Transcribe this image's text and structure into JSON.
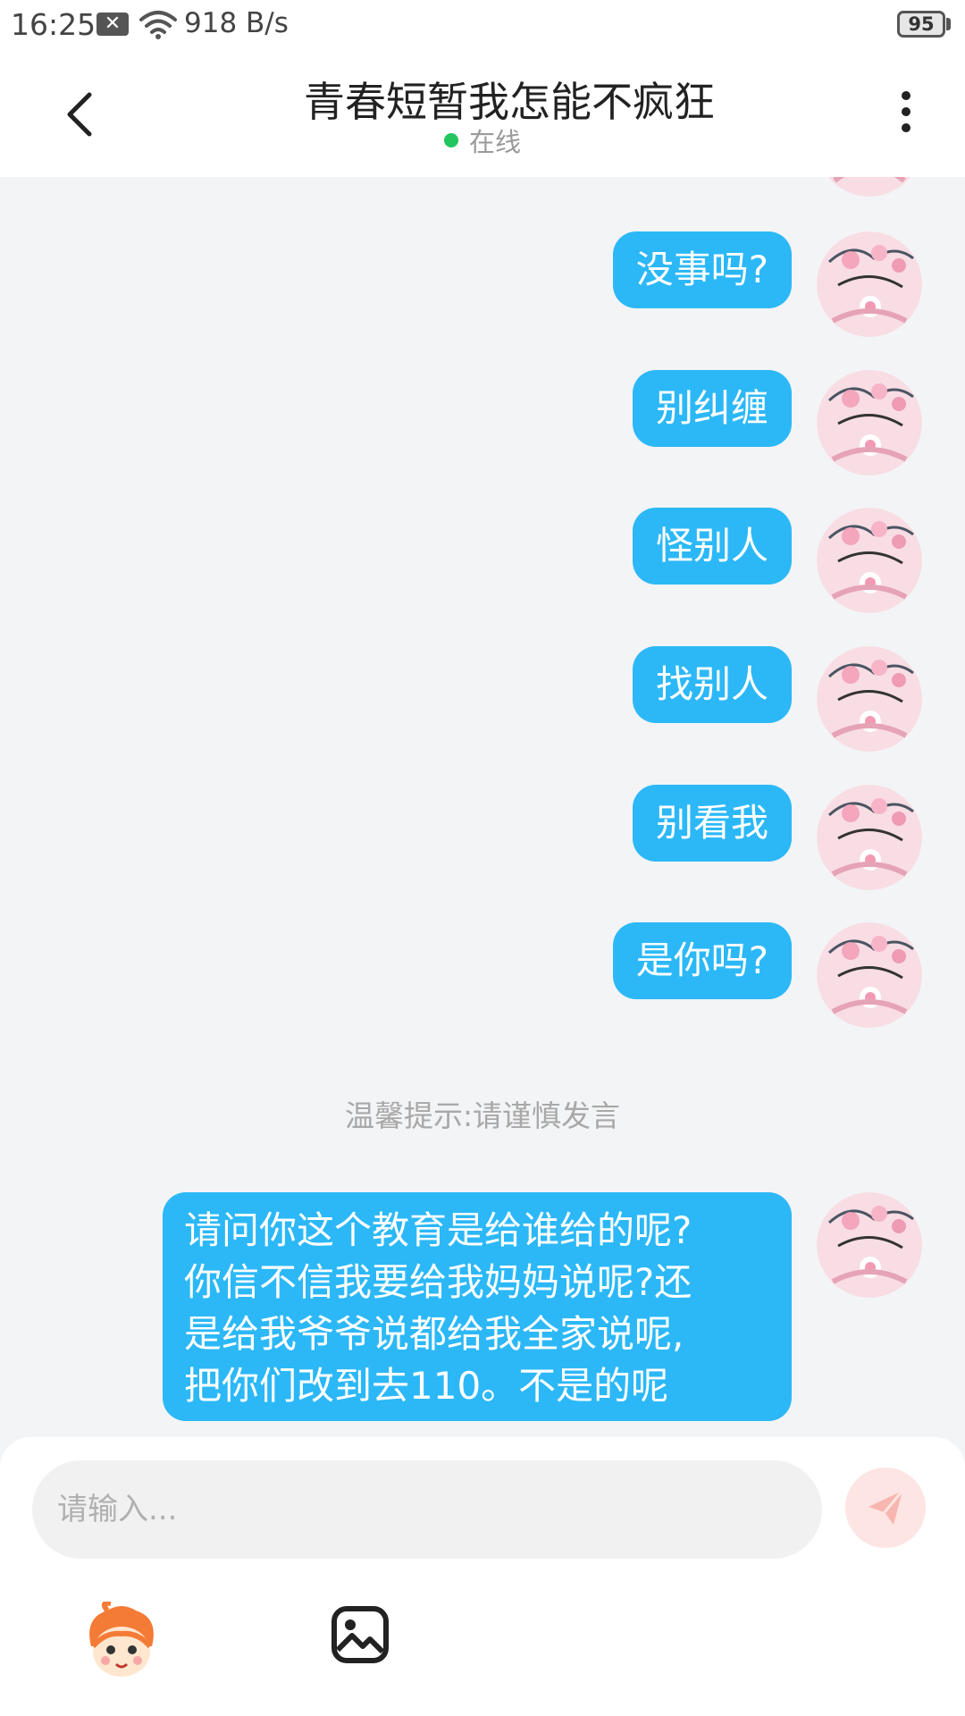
{
  "status_bar": {
    "time": "16:25",
    "notification_icon": "x-box-icon",
    "wifi_icon": "wifi-icon",
    "net_speed": "918 B/s",
    "battery": "95"
  },
  "header": {
    "back_icon": "chevron-left-icon",
    "title": "青春短暂我怎能不疯狂",
    "presence": "在线",
    "presence_color": "#22c55e",
    "more_icon": "more-vertical-icon"
  },
  "messages": [
    {
      "text": "没事吗?"
    },
    {
      "text": "别纠缠"
    },
    {
      "text": "怪别人"
    },
    {
      "text": "找别人"
    },
    {
      "text": "别看我"
    },
    {
      "text": "是你吗?"
    }
  ],
  "tip": "温馨提示:请谨慎发言",
  "last_message": {
    "lines": [
      "请问你这个教育是给谁给的呢?",
      "你信不信我要给我妈妈说呢?还",
      "是给我爷爷说都给我全家说呢,",
      "把你们改到去110。不是的呢"
    ]
  },
  "composer": {
    "placeholder": "请输入...",
    "send_icon": "paper-plane-icon",
    "emoji_icon": "cartoon-face-icon",
    "image_icon": "image-icon"
  },
  "colors": {
    "bubble": "#2cb8f7",
    "background": "#f3f4f6",
    "send_button": "#fde5e3"
  }
}
